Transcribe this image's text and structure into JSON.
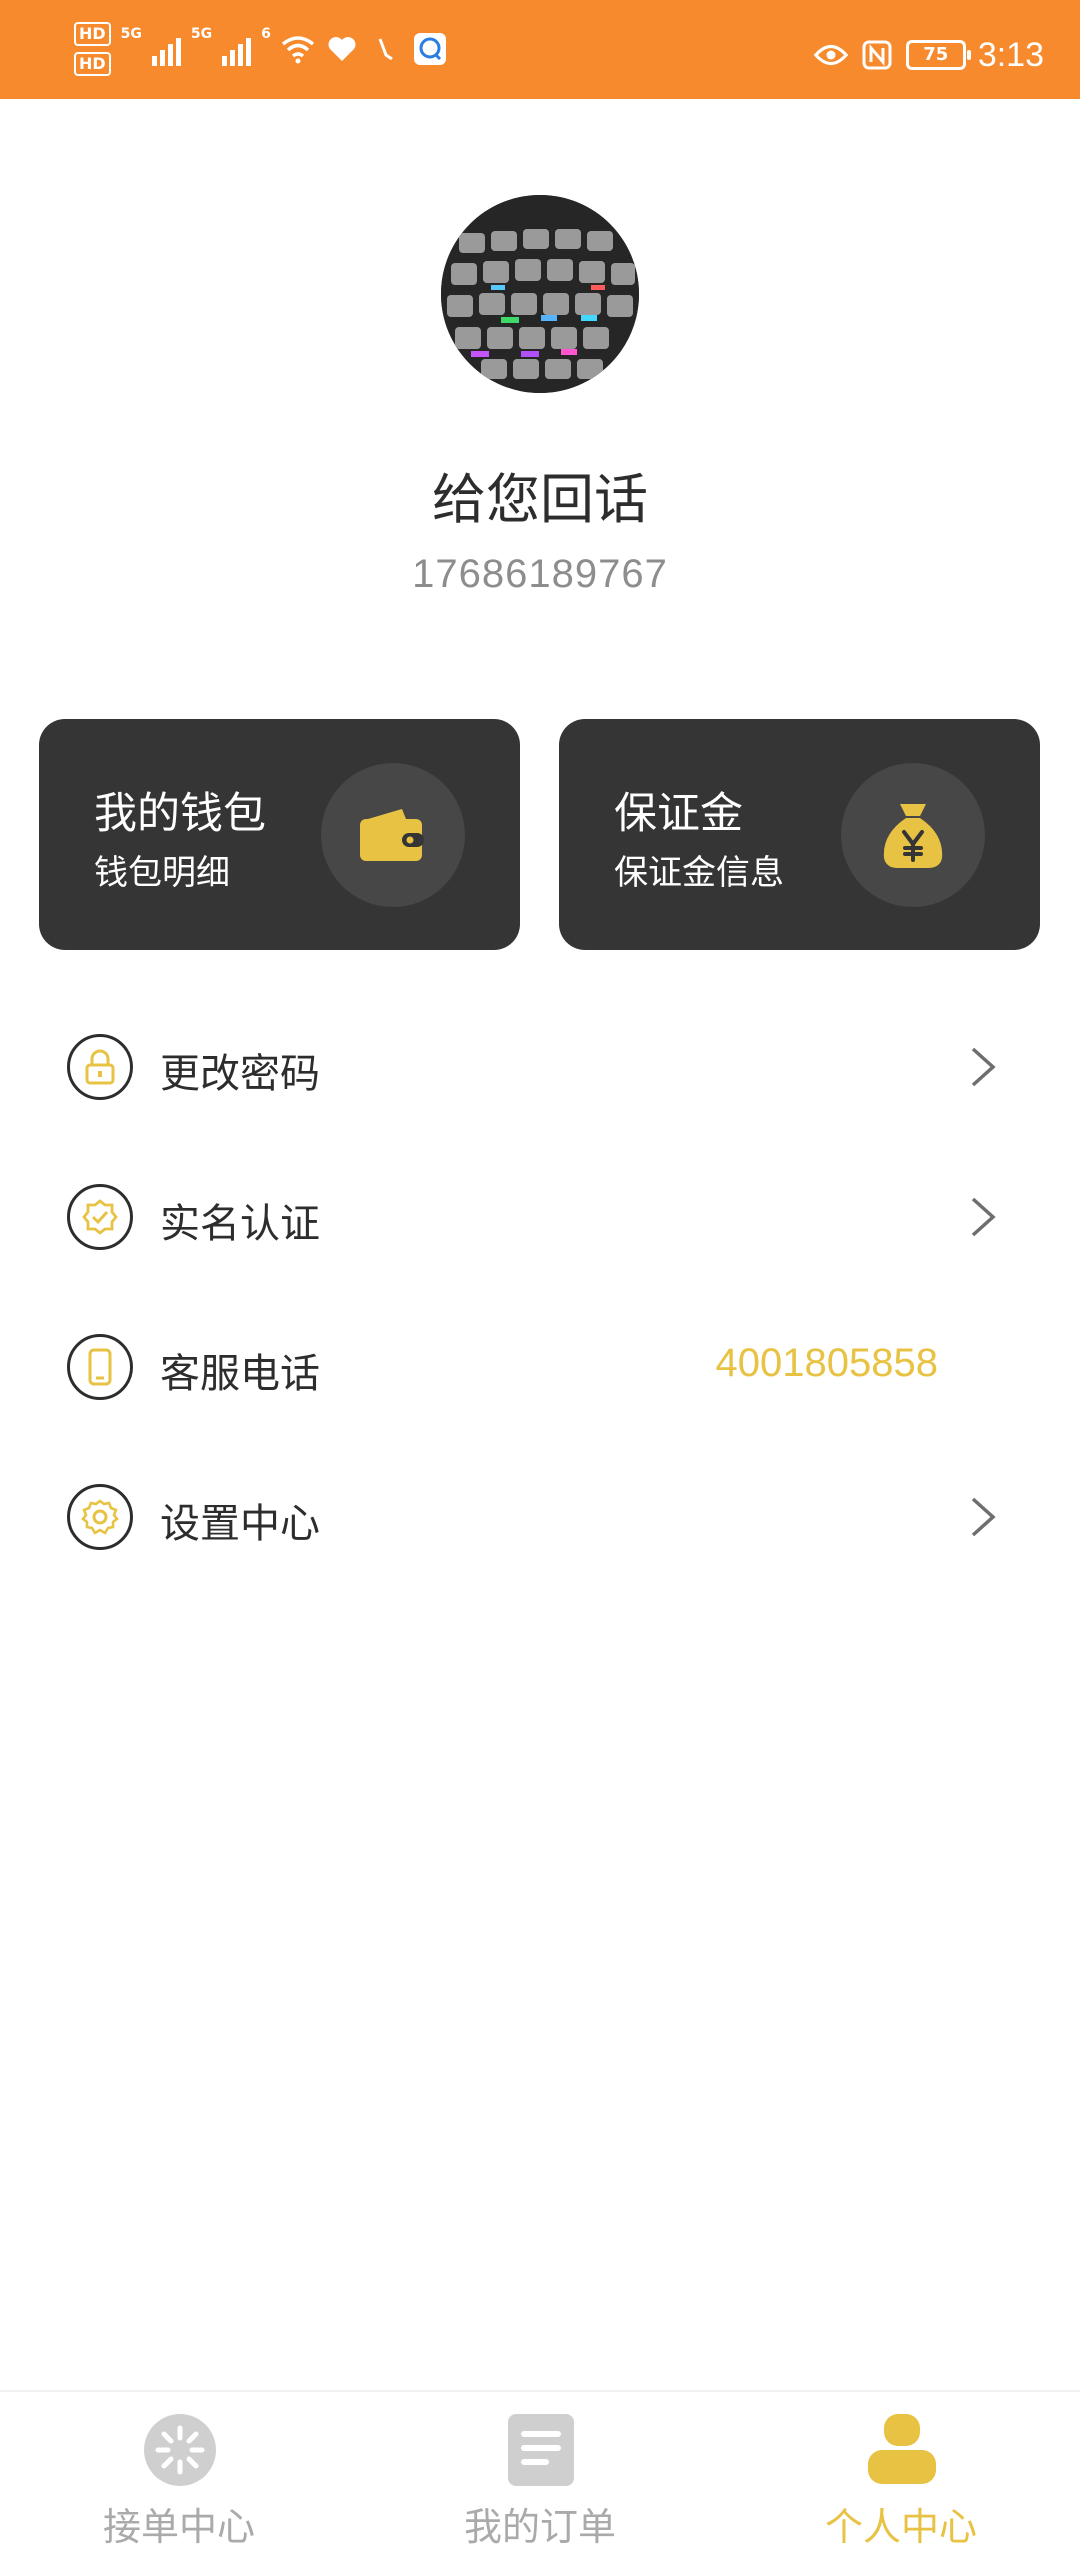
{
  "status_bar": {
    "hd1": "HD",
    "hd2": "HD",
    "net1": "5G",
    "net2": "5G",
    "wifi_sup": "6",
    "battery": "75",
    "time": "3:13"
  },
  "profile": {
    "nickname": "给您回话",
    "phone": "17686189767"
  },
  "cards": {
    "wallet": {
      "title": "我的钱包",
      "subtitle": "钱包明细",
      "icon": "wallet-icon"
    },
    "deposit": {
      "title": "保证金",
      "subtitle": "保证金信息",
      "icon": "money-bag-icon"
    }
  },
  "menu": {
    "change_password": {
      "label": "更改密码",
      "icon": "lock-icon"
    },
    "real_name": {
      "label": "实名认证",
      "icon": "verified-badge-icon"
    },
    "service_phone": {
      "label": "客服电话",
      "value": "4001805858",
      "icon": "mobile-phone-icon"
    },
    "settings": {
      "label": "设置中心",
      "icon": "gear-icon"
    }
  },
  "tabs": [
    {
      "label": "接单中心",
      "icon": "loading-icon",
      "active": false
    },
    {
      "label": "我的订单",
      "icon": "document-icon",
      "active": false
    },
    {
      "label": "个人中心",
      "icon": "user-icon",
      "active": true
    }
  ],
  "colors": {
    "status_bar": "#f68a2c",
    "accent": "#e8c243",
    "card_bg": "#353535"
  }
}
